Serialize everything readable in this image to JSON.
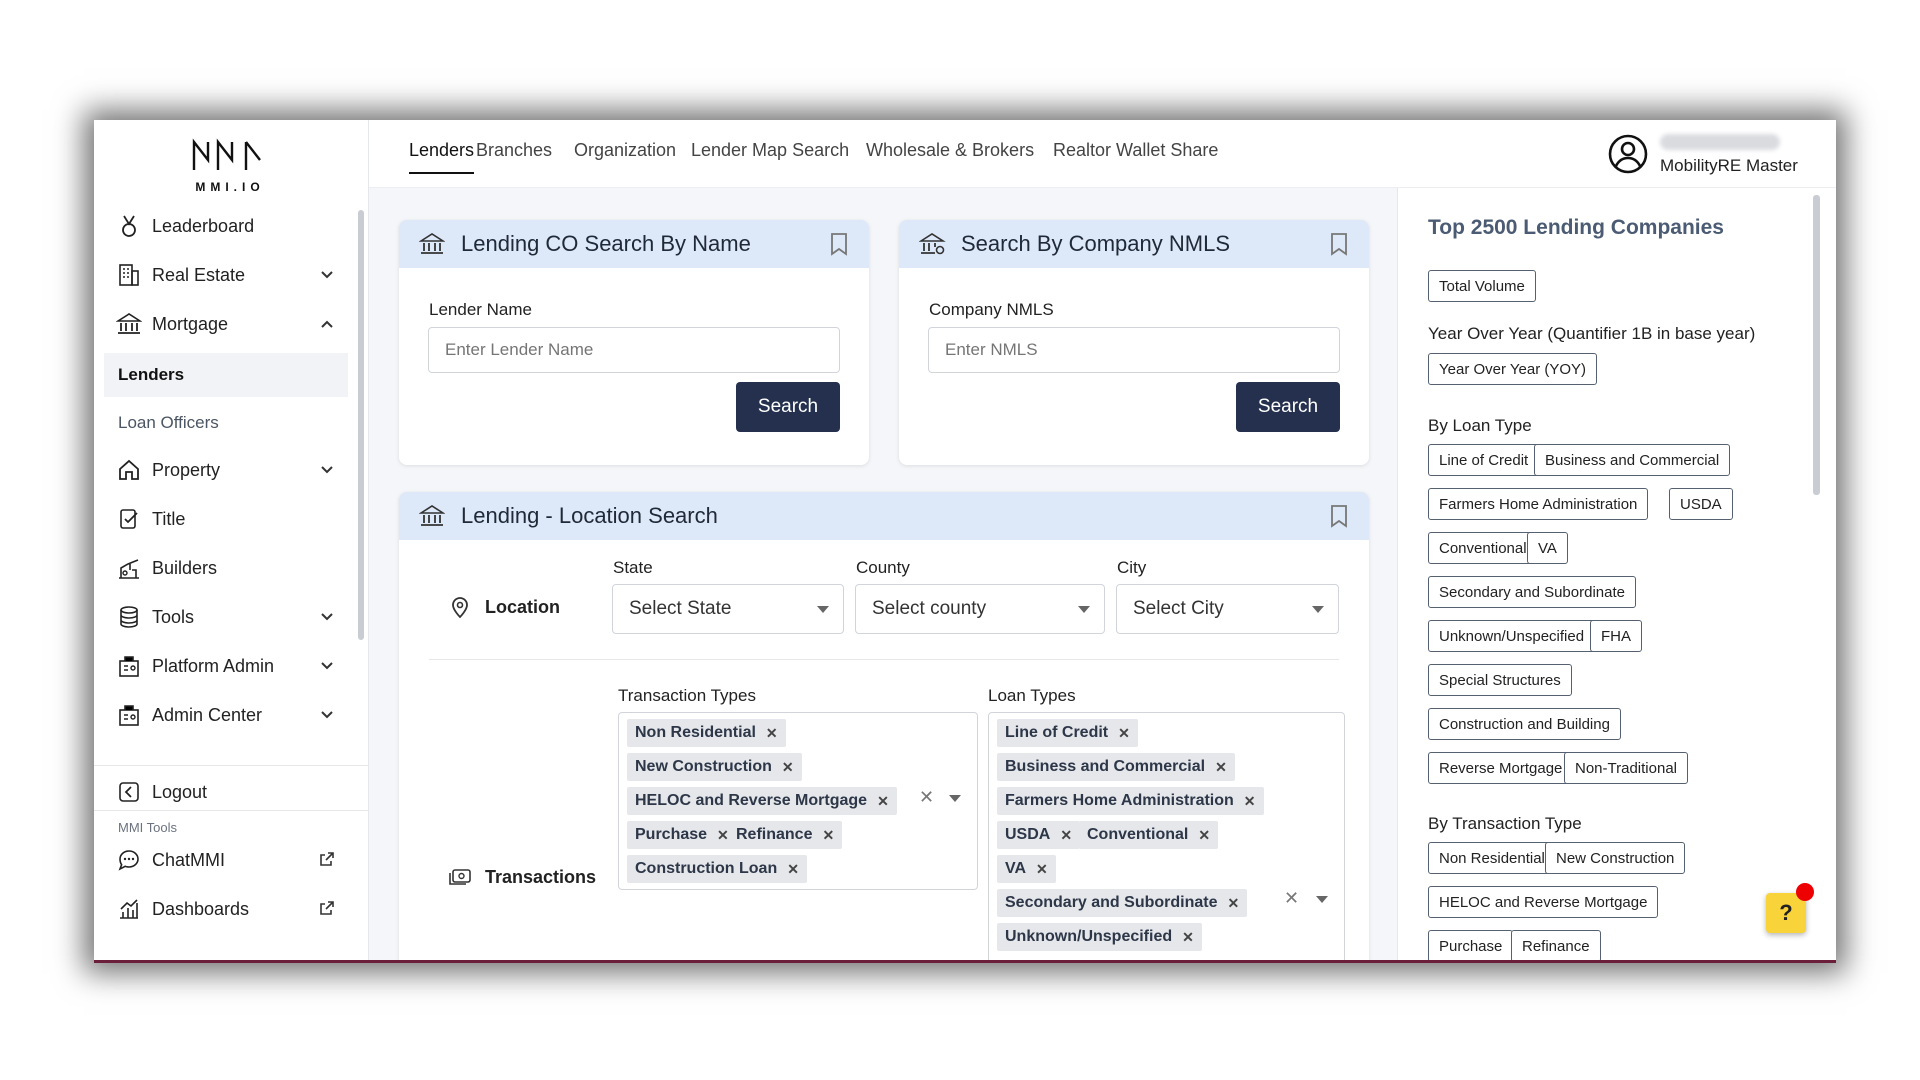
{
  "app": {
    "logo_text": "MMI.IO"
  },
  "sidebar": {
    "items": [
      {
        "label": "Leaderboard"
      },
      {
        "label": "Real Estate"
      },
      {
        "label": "Mortgage"
      },
      {
        "label": "Lenders"
      },
      {
        "label": "Loan Officers"
      },
      {
        "label": "Property"
      },
      {
        "label": "Title"
      },
      {
        "label": "Builders"
      },
      {
        "label": "Tools"
      },
      {
        "label": "Platform Admin"
      },
      {
        "label": "Admin Center"
      }
    ],
    "logout": "Logout",
    "tools_heading": "MMI Tools",
    "chat": "ChatMMI",
    "dashboards": "Dashboards"
  },
  "tabs": [
    "Lenders",
    "Branches",
    "Organization",
    "Lender Map Search",
    "Wholesale & Brokers",
    "Realtor Wallet Share"
  ],
  "user": {
    "role": "MobilityRE Master"
  },
  "name_search": {
    "title": "Lending CO Search By Name",
    "label": "Lender Name",
    "placeholder": "Enter Lender Name",
    "button": "Search"
  },
  "nmls_search": {
    "title": "Search By Company NMLS",
    "label": "Company NMLS",
    "placeholder": "Enter NMLS",
    "button": "Search"
  },
  "location_search": {
    "title": "Lending - Location Search",
    "location_label": "Location",
    "state_label": "State",
    "state_value": "Select State",
    "county_label": "County",
    "county_value": "Select county",
    "city_label": "City",
    "city_value": "Select City",
    "transactions_label": "Transactions",
    "transaction_types_label": "Transaction Types",
    "loan_types_label": "Loan Types",
    "transaction_chips": [
      "Non Residential",
      "New Construction",
      "HELOC and Reverse Mortgage",
      "Purchase",
      "Refinance",
      "Construction Loan"
    ],
    "loan_chips": [
      "Line of Credit",
      "Business and Commercial",
      "Farmers Home Administration",
      "USDA",
      "Conventional",
      "VA",
      "Secondary and Subordinate",
      "Unknown/Unspecified"
    ]
  },
  "right_panel": {
    "title": "Top 2500 Lending Companies",
    "total_volume": "Total Volume",
    "yoy_label": "Year Over Year (Quantifier 1B in base year)",
    "yoy_tag": "Year Over Year (YOY)",
    "loan_type_label": "By Loan Type",
    "loan_type_tags": [
      "Line of Credit",
      "Business and Commercial",
      "Farmers Home Administration",
      "USDA",
      "Conventional",
      "VA",
      "Secondary and Subordinate",
      "Unknown/Unspecified",
      "FHA",
      "Special Structures",
      "Construction and Building",
      "Reverse Mortgage",
      "Non-Traditional"
    ],
    "transaction_type_label": "By Transaction Type",
    "transaction_type_tags": [
      "Non Residential",
      "New Construction",
      "HELOC and Reverse Mortgage",
      "Purchase",
      "Refinance"
    ]
  },
  "help": {
    "label": "?"
  }
}
